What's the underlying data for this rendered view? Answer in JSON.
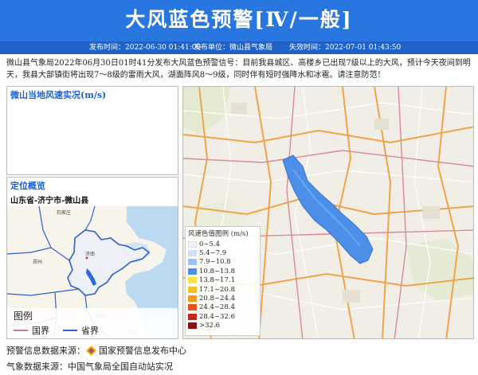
{
  "header": {
    "title": "大风蓝色预警[Ⅳ/一般]",
    "bg_color": "#2a76e0"
  },
  "meta": {
    "publish_time": "发布时间：2022-06-30 01:41:00",
    "publisher": "发布单位：微山县气象局",
    "expire_time": "失效时间：2022-07-01 01:43:50"
  },
  "bulletin": "微山县气象局2022年06月30日01时41分发布大风蓝色预警信号：目前我县城区、高楼乡已出现7级以上的大风，预计今天夜间到明天，我县大部镇街将出现7～8级的雷雨大风，湖面阵风8～9级，同时伴有短时强降水和冰雹。请注意防范！",
  "wind_panel": {
    "title": "微山当地风速实况(m/s)"
  },
  "location_panel": {
    "title": "定位概览",
    "subtitle": "山东省-济宁市-微山县",
    "legend_title": "图例",
    "legend_items": [
      {
        "label": "国界",
        "color": "#c97a8f"
      },
      {
        "label": "省界",
        "color": "#2d5fd0"
      }
    ]
  },
  "wind_legend": {
    "title": "风速色值图例 (m/s)",
    "items": [
      {
        "label": "0~5.4",
        "color": "#eef3fa"
      },
      {
        "label": "5.4~7.9",
        "color": "#cfe0f6"
      },
      {
        "label": "7.9~10.8",
        "color": "#9cc3f0"
      },
      {
        "label": "10.8~13.8",
        "color": "#4c8fe8"
      },
      {
        "label": "13.8~17.1",
        "color": "#f7e34b"
      },
      {
        "label": "17.1~20.8",
        "color": "#f5c027"
      },
      {
        "label": "20.8~24.4",
        "color": "#f39a1d"
      },
      {
        "label": "24.4~28.4",
        "color": "#e9531a"
      },
      {
        "label": "28.4~32.6",
        "color": "#c92519"
      },
      {
        "label": ">32.6",
        "color": "#8e0f10"
      }
    ]
  },
  "footer": {
    "warning_source": "预警信息数据来源：",
    "warning_source_name": "国家预警信息发布中心",
    "weather_source": "气象数据来源：中国气象局全国自动站实况"
  }
}
